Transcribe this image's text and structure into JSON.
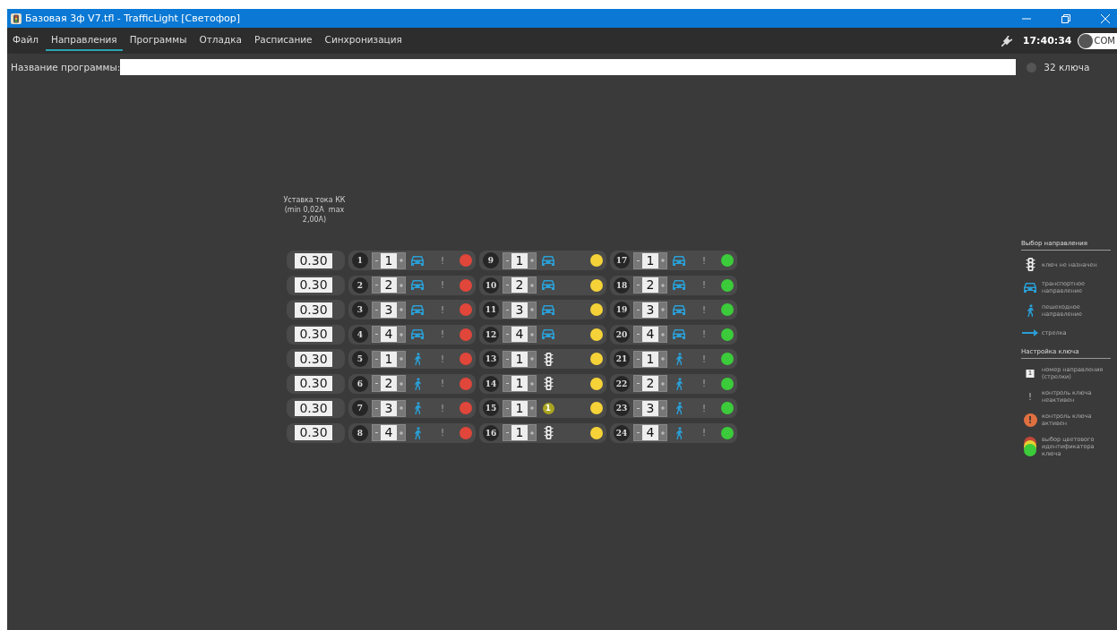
{
  "window": {
    "title": "Базовая 3ф V7.tfl - TrafficLight [Светофор]"
  },
  "menu": [
    {
      "label": "Файл",
      "selected": false
    },
    {
      "label": "Направления",
      "selected": true
    },
    {
      "label": "Программы",
      "selected": false
    },
    {
      "label": "Отладка",
      "selected": false
    },
    {
      "label": "Расписание",
      "selected": false
    },
    {
      "label": "Синхронизация",
      "selected": false
    }
  ],
  "status": {
    "time": "17:40:34",
    "port": "COM",
    "connected": false
  },
  "program": {
    "label": "Название программы:",
    "keys_label": "32 ключа",
    "keys_active": false
  },
  "current_header": "Уставка тока КК\n(min 0,02A  max\n2,00A)",
  "currents": [
    "0.30",
    "0.30",
    "0.30",
    "0.30",
    "0.30",
    "0.30",
    "0.30",
    "0.30"
  ],
  "groups": [
    {
      "keys": [
        {
          "number": "1",
          "direction": "1",
          "kind": "car",
          "control": "!",
          "color": "#e0463a"
        },
        {
          "number": "2",
          "direction": "2",
          "kind": "car",
          "control": "!",
          "color": "#e0463a"
        },
        {
          "number": "3",
          "direction": "3",
          "kind": "car",
          "control": "!",
          "color": "#e0463a"
        },
        {
          "number": "4",
          "direction": "4",
          "kind": "car",
          "control": "!",
          "color": "#e0463a"
        },
        {
          "number": "5",
          "direction": "1",
          "kind": "pedestrian",
          "control": "!",
          "color": "#e0463a"
        },
        {
          "number": "6",
          "direction": "2",
          "kind": "pedestrian",
          "control": "!",
          "color": "#e0463a"
        },
        {
          "number": "7",
          "direction": "3",
          "kind": "pedestrian",
          "control": "!",
          "color": "#e0463a"
        },
        {
          "number": "8",
          "direction": "4",
          "kind": "pedestrian",
          "control": "!",
          "color": "#e0463a"
        }
      ]
    },
    {
      "keys": [
        {
          "number": "9",
          "direction": "1",
          "kind": "car",
          "color": "#f5d338"
        },
        {
          "number": "10",
          "direction": "2",
          "kind": "car",
          "color": "#f5d338"
        },
        {
          "number": "11",
          "direction": "3",
          "kind": "car",
          "color": "#f5d338"
        },
        {
          "number": "12",
          "direction": "4",
          "kind": "car",
          "color": "#f5d338"
        },
        {
          "number": "13",
          "direction": "1",
          "kind": "unassigned",
          "color": "#f5d338"
        },
        {
          "number": "14",
          "direction": "1",
          "kind": "unassigned",
          "color": "#f5d338"
        },
        {
          "number": "15",
          "direction": "1",
          "kind": "badge",
          "badge": "1",
          "color": "#f5d338"
        },
        {
          "number": "16",
          "direction": "1",
          "kind": "unassigned",
          "color": "#f5d338"
        }
      ]
    },
    {
      "keys": [
        {
          "number": "17",
          "direction": "1",
          "kind": "car",
          "control": "!",
          "color": "#3ccb3a"
        },
        {
          "number": "18",
          "direction": "2",
          "kind": "car",
          "control": "!",
          "color": "#3ccb3a"
        },
        {
          "number": "19",
          "direction": "3",
          "kind": "car",
          "control": "!",
          "color": "#3ccb3a"
        },
        {
          "number": "20",
          "direction": "4",
          "kind": "car",
          "control": "!",
          "color": "#3ccb3a"
        },
        {
          "number": "21",
          "direction": "1",
          "kind": "pedestrian",
          "control": "!",
          "color": "#3ccb3a"
        },
        {
          "number": "22",
          "direction": "2",
          "kind": "pedestrian",
          "control": "!",
          "color": "#3ccb3a"
        },
        {
          "number": "23",
          "direction": "3",
          "kind": "pedestrian",
          "control": "!",
          "color": "#3ccb3a"
        },
        {
          "number": "24",
          "direction": "4",
          "kind": "pedestrian",
          "control": "!",
          "color": "#3ccb3a"
        }
      ]
    }
  ],
  "legend": [
    {
      "title": "Выбор направления",
      "items": [
        {
          "kind": "unassigned",
          "label": "ключ не назначен"
        },
        {
          "kind": "car",
          "label": "транспортное направление"
        },
        {
          "kind": "pedestrian",
          "label": "пешеходное направление"
        },
        {
          "kind": "arrow",
          "label": "стрелка"
        }
      ]
    },
    {
      "title": "Настройка ключа",
      "items": [
        {
          "kind": "number",
          "label": "номер направления (стрелки)",
          "glyph": "1"
        },
        {
          "kind": "control-off",
          "label": "контроль ключа неактивен",
          "glyph": "!"
        },
        {
          "kind": "control-on",
          "label": "контроль ключа активен",
          "glyph": "!"
        },
        {
          "kind": "colors",
          "label": "выбор цветового идентификатора ключа"
        }
      ]
    }
  ]
}
